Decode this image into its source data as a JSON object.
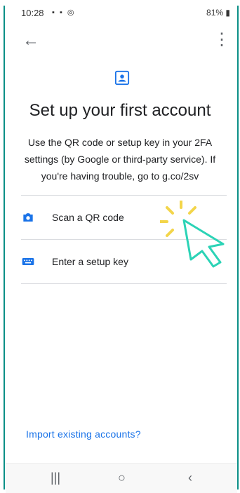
{
  "status_bar": {
    "time": "10:28",
    "icons_left": "▪ ▪ ◎",
    "battery": "81%"
  },
  "toolbar": {
    "back_icon": "arrow-left-icon",
    "menu_icon": "more-vert-icon"
  },
  "header": {
    "title": "Set up your first account",
    "description": "Use the QR code or setup key in your 2FA settings (by Google or third-party service). If you're having trouble, go to g.co/2sv"
  },
  "options": [
    {
      "label": "Scan a QR code",
      "icon": "camera-icon"
    },
    {
      "label": "Enter a setup key",
      "icon": "keyboard-icon"
    }
  ],
  "footer": {
    "import_label": "Import existing accounts?"
  },
  "nav_bar": {
    "recent": "|||",
    "home": "○",
    "back": "‹"
  },
  "colors": {
    "accent": "#1a73e8",
    "border": "#0b8f87",
    "cursor": "#2bd3b6",
    "burst": "#f3d54a"
  }
}
